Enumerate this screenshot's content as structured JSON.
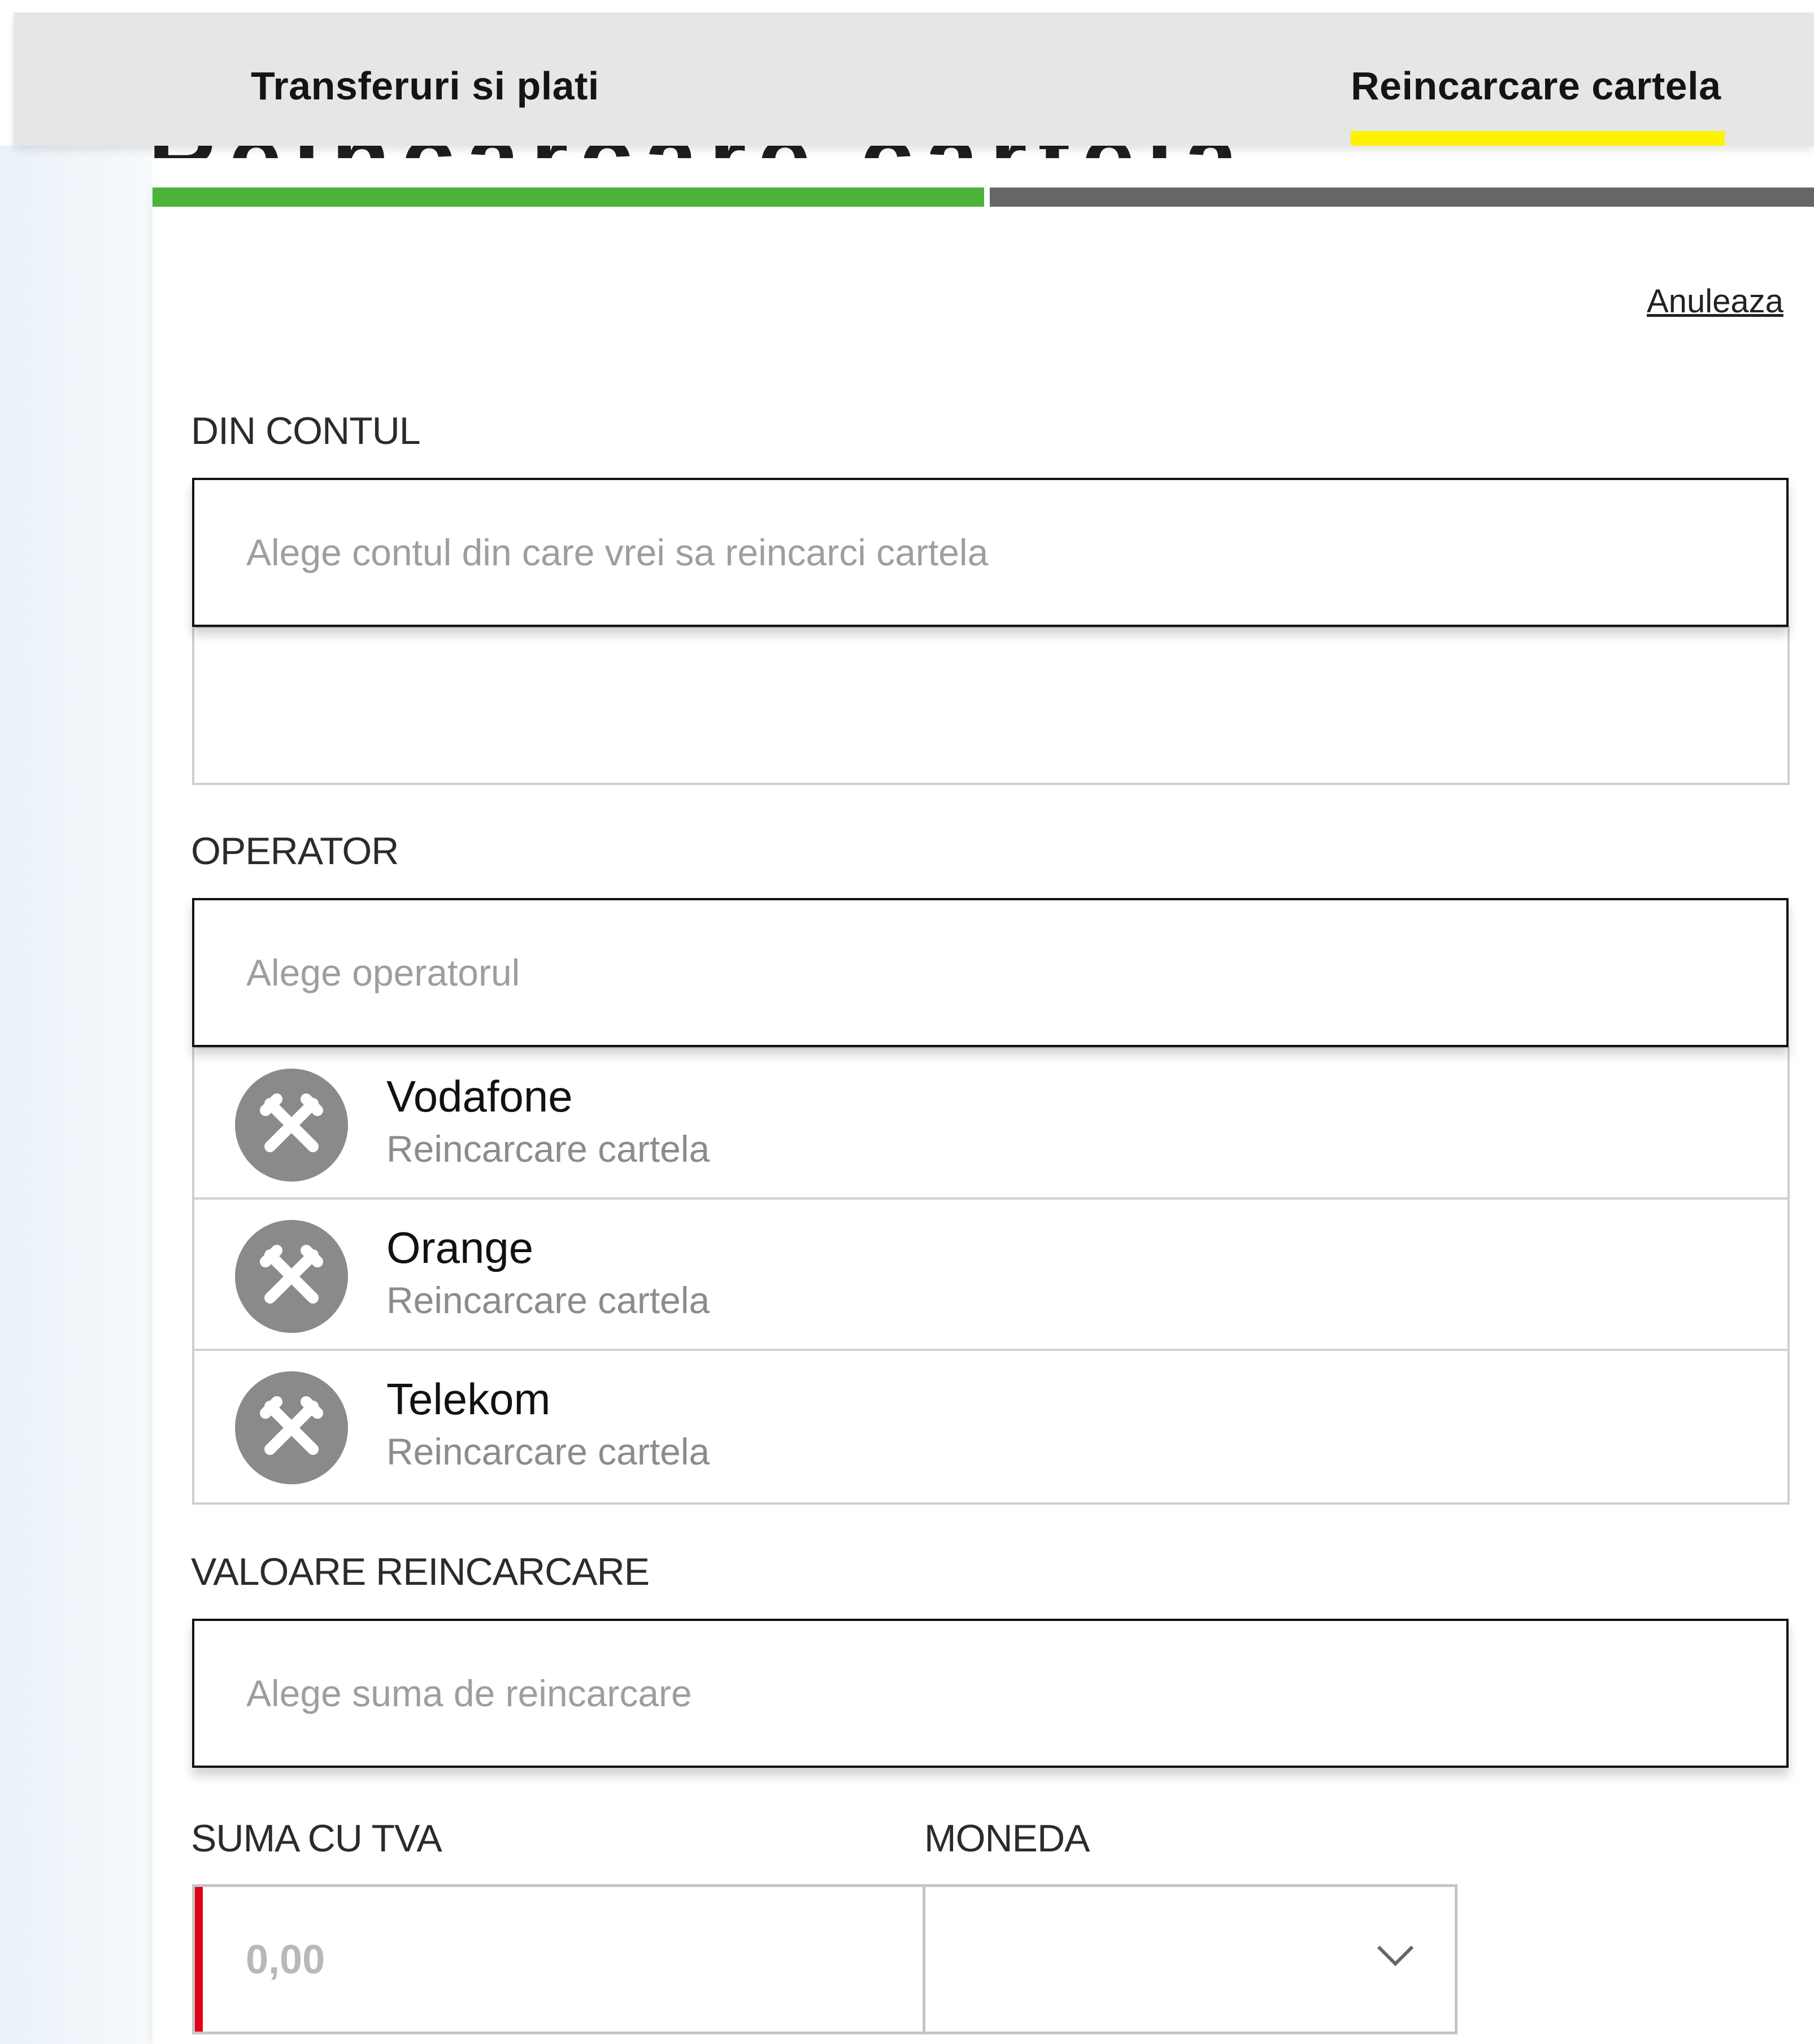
{
  "tabs": [
    {
      "label": "Transferuri si plati",
      "active": false
    },
    {
      "label": "Reincarcare cartela",
      "active": true
    }
  ],
  "page_title_partial": "Reincarcare cartela",
  "progress": {
    "completed_fraction": 0.5
  },
  "cancel_label": "Anuleaza",
  "from_account": {
    "label": "DIN CONTUL",
    "placeholder": "Alege contul din care vrei sa reincarci cartela"
  },
  "operator": {
    "label": "OPERATOR",
    "placeholder": "Alege operatorul",
    "options": [
      {
        "name": "Vodafone",
        "subtitle": "Reincarcare cartela"
      },
      {
        "name": "Orange",
        "subtitle": "Reincarcare cartela"
      },
      {
        "name": "Telekom",
        "subtitle": "Reincarcare cartela"
      }
    ]
  },
  "recharge_value": {
    "label": "VALOARE REINCARCARE",
    "placeholder": "Alege suma de reincarcare"
  },
  "amount_with_vat": {
    "label": "SUMA CU TVA",
    "value": "0,00"
  },
  "currency": {
    "label": "MONEDA",
    "value": ""
  },
  "colors": {
    "tab_active_underline": "#fff200",
    "progress_done": "#4cb33b",
    "progress_todo": "#666666",
    "error_marker": "#e2001a",
    "topbar_bg": "#e6e6e6"
  },
  "icons": {
    "operator_logo": "raiffeisen-crossed-gables-icon",
    "currency_dropdown": "chevron-down-icon"
  }
}
